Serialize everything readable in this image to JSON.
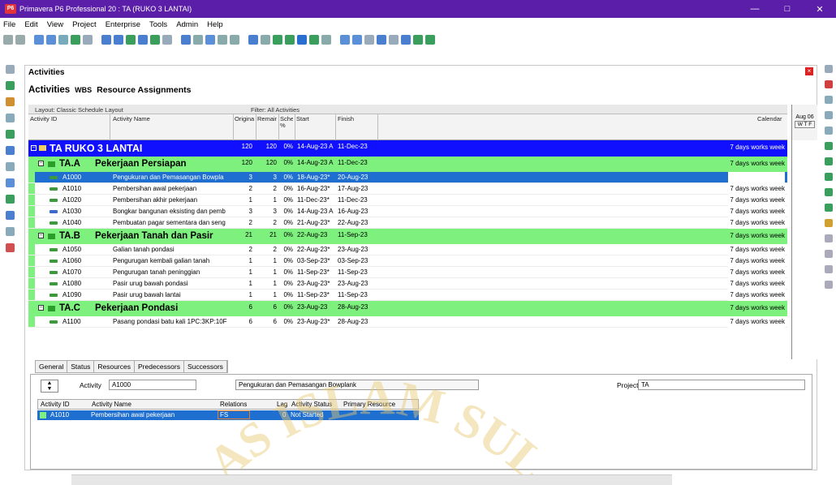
{
  "window": {
    "title": "Primavera P6 Professional 20 : TA (RUKO 3 LANTAI)",
    "minimize": "—",
    "maximize": "□",
    "close": "✕"
  },
  "menu": [
    "File",
    "Edit",
    "View",
    "Project",
    "Enterprise",
    "Tools",
    "Admin",
    "Help"
  ],
  "panel": {
    "title": "Activities",
    "close": "×"
  },
  "tabs": {
    "activities": "Activities",
    "wbs": "WBS",
    "resource_assignments": "Resource Assignments"
  },
  "layout": {
    "layout_label": "Layout: Classic Schedule Layout",
    "filter_label": "Filter: All Activities"
  },
  "columns": {
    "activity_id": "Activity ID",
    "activity_name": "Activity Name",
    "original": "Original",
    "remaining": "Remaining",
    "schedule": "Schedule %",
    "start": "Start",
    "finish": "Finish",
    "calendar": "Calendar"
  },
  "gantt": {
    "month": "Aug 06",
    "days": "W T F"
  },
  "rows": [
    {
      "type": "proj",
      "id": "TA RUKO 3 LANTAI",
      "name": "",
      "orig": "120",
      "rem": "120",
      "sched": "0%",
      "start": "14-Aug-23 A",
      "finish": "11-Dec-23",
      "cal": "7 days works week"
    },
    {
      "type": "wbs",
      "id": "TA.A",
      "name": "Pekerjaan Persiapan",
      "orig": "120",
      "rem": "120",
      "sched": "0%",
      "start": "14-Aug-23 A",
      "finish": "11-Dec-23",
      "cal": "7 days works week"
    },
    {
      "type": "sel",
      "id": "A1000",
      "name": "Pengukuran dan Pemasangan Bowpla",
      "orig": "3",
      "rem": "3",
      "sched": "0%",
      "start": "18-Aug-23*",
      "finish": "20-Aug-23",
      "cal": "7 days works week"
    },
    {
      "type": "act",
      "id": "A1010",
      "name": "Pembersihan awal pekerjaan",
      "orig": "2",
      "rem": "2",
      "sched": "0%",
      "start": "16-Aug-23*",
      "finish": "17-Aug-23",
      "cal": "7 days works week"
    },
    {
      "type": "act",
      "id": "A1020",
      "name": "Pembersihan akhir pekerjaan",
      "orig": "1",
      "rem": "1",
      "sched": "0%",
      "start": "11-Dec-23*",
      "finish": "11-Dec-23",
      "cal": "7 days works week"
    },
    {
      "type": "act",
      "id": "A1030",
      "name": "Bongkar bangunan eksisting dan pemb",
      "orig": "3",
      "rem": "3",
      "sched": "0%",
      "start": "14-Aug-23 A",
      "finish": "16-Aug-23",
      "cal": "7 days works week",
      "blue": true
    },
    {
      "type": "act",
      "id": "A1040",
      "name": "Pembuatan pagar sementara dan seng",
      "orig": "2",
      "rem": "2",
      "sched": "0%",
      "start": "21-Aug-23*",
      "finish": "22-Aug-23",
      "cal": "7 days works week"
    },
    {
      "type": "wbs",
      "id": "TA.B",
      "name": "Pekerjaan Tanah dan Pasir",
      "orig": "21",
      "rem": "21",
      "sched": "0%",
      "start": "22-Aug-23",
      "finish": "11-Sep-23",
      "cal": "7 days works week"
    },
    {
      "type": "act",
      "id": "A1050",
      "name": "Galian tanah pondasi",
      "orig": "2",
      "rem": "2",
      "sched": "0%",
      "start": "22-Aug-23*",
      "finish": "23-Aug-23",
      "cal": "7 days works week"
    },
    {
      "type": "act",
      "id": "A1060",
      "name": "Pengurugan kembali galian tanah",
      "orig": "1",
      "rem": "1",
      "sched": "0%",
      "start": "03-Sep-23*",
      "finish": "03-Sep-23",
      "cal": "7 days works week"
    },
    {
      "type": "act",
      "id": "A1070",
      "name": "Pengurugan tanah peninggian",
      "orig": "1",
      "rem": "1",
      "sched": "0%",
      "start": "11-Sep-23*",
      "finish": "11-Sep-23",
      "cal": "7 days works week"
    },
    {
      "type": "act",
      "id": "A1080",
      "name": "Pasir urug bawah pondasi",
      "orig": "1",
      "rem": "1",
      "sched": "0%",
      "start": "23-Aug-23*",
      "finish": "23-Aug-23",
      "cal": "7 days works week"
    },
    {
      "type": "act",
      "id": "A1090",
      "name": "Pasir urug bawah lantai",
      "orig": "1",
      "rem": "1",
      "sched": "0%",
      "start": "11-Sep-23*",
      "finish": "11-Sep-23",
      "cal": "7 days works week"
    },
    {
      "type": "wbs",
      "id": "TA.C",
      "name": "Pekerjaan Pondasi",
      "orig": "6",
      "rem": "6",
      "sched": "0%",
      "start": "23-Aug-23",
      "finish": "28-Aug-23",
      "cal": "7 days works week"
    },
    {
      "type": "act",
      "id": "A1100",
      "name": "Pasang pondasi batu kali 1PC:3KP:10F",
      "orig": "6",
      "rem": "6",
      "sched": "0%",
      "start": "23-Aug-23*",
      "finish": "28-Aug-23",
      "cal": "7 days works week"
    }
  ],
  "bottom": {
    "tabs": [
      "General",
      "Status",
      "Resources",
      "Predecessors",
      "Successors"
    ],
    "activity_label": "Activity",
    "activity_value": "A1000",
    "activity_name": "Pengukuran dan Pemasangan Bowplank",
    "project_label": "Project",
    "project_value": "TA",
    "grid_headers": {
      "id": "Activity ID",
      "name": "Activity Name",
      "relation": "Relations",
      "lag": "Lag",
      "status": "Activity Status",
      "resource": "Primary Resource"
    },
    "grid_row": {
      "id": "A1010",
      "name": "Pembersihan awal pekerjaan",
      "relation": "FS",
      "lag": "0",
      "status": "Not Started",
      "resource": ""
    }
  },
  "watermark": {
    "text": "AS ISLAM SUL"
  }
}
